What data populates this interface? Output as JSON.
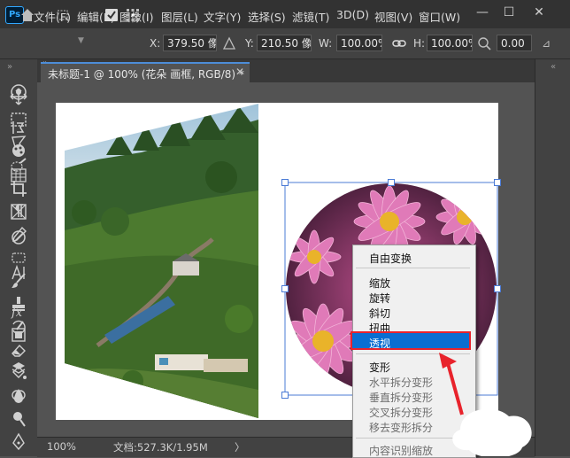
{
  "app": {
    "logo_text": "Ps"
  },
  "menu": [
    "文件(F)",
    "编辑(E)",
    "图像(I)",
    "图层(L)",
    "文字(Y)",
    "选择(S)",
    "滤镜(T)",
    "3D(D)",
    "视图(V)",
    "窗口(W)"
  ],
  "window_controls": {
    "minimize": "—",
    "restore": "☐",
    "close": "✕"
  },
  "options": {
    "x_label": "X:",
    "x_value": "379.50 像",
    "y_label": "Y:",
    "y_value": "210.50 像",
    "w_label": "W:",
    "w_value": "100.00%",
    "h_label": "H:",
    "h_value": "100.00%",
    "angle_value": "0.00"
  },
  "document": {
    "tab_title": "未标题-1 @ 100% (花朵 画框, RGB/8) *",
    "tab_close": "✕"
  },
  "status": {
    "zoom": "100%",
    "doc_info": "文档:527.3K/1.95M",
    "arrow": "〉"
  },
  "context_menu": {
    "items": [
      "自由变换",
      "缩放",
      "旋转",
      "斜切",
      "扭曲",
      "透视",
      "变形",
      "水平拆分变形",
      "垂直拆分变形",
      "交叉拆分变形",
      "移去变形拆分",
      "内容识别缩放"
    ],
    "highlighted": "透视"
  },
  "colors": {
    "highlight": "#0a6ed1",
    "callout": "#e8232c",
    "selection": "#4b7bd6"
  }
}
